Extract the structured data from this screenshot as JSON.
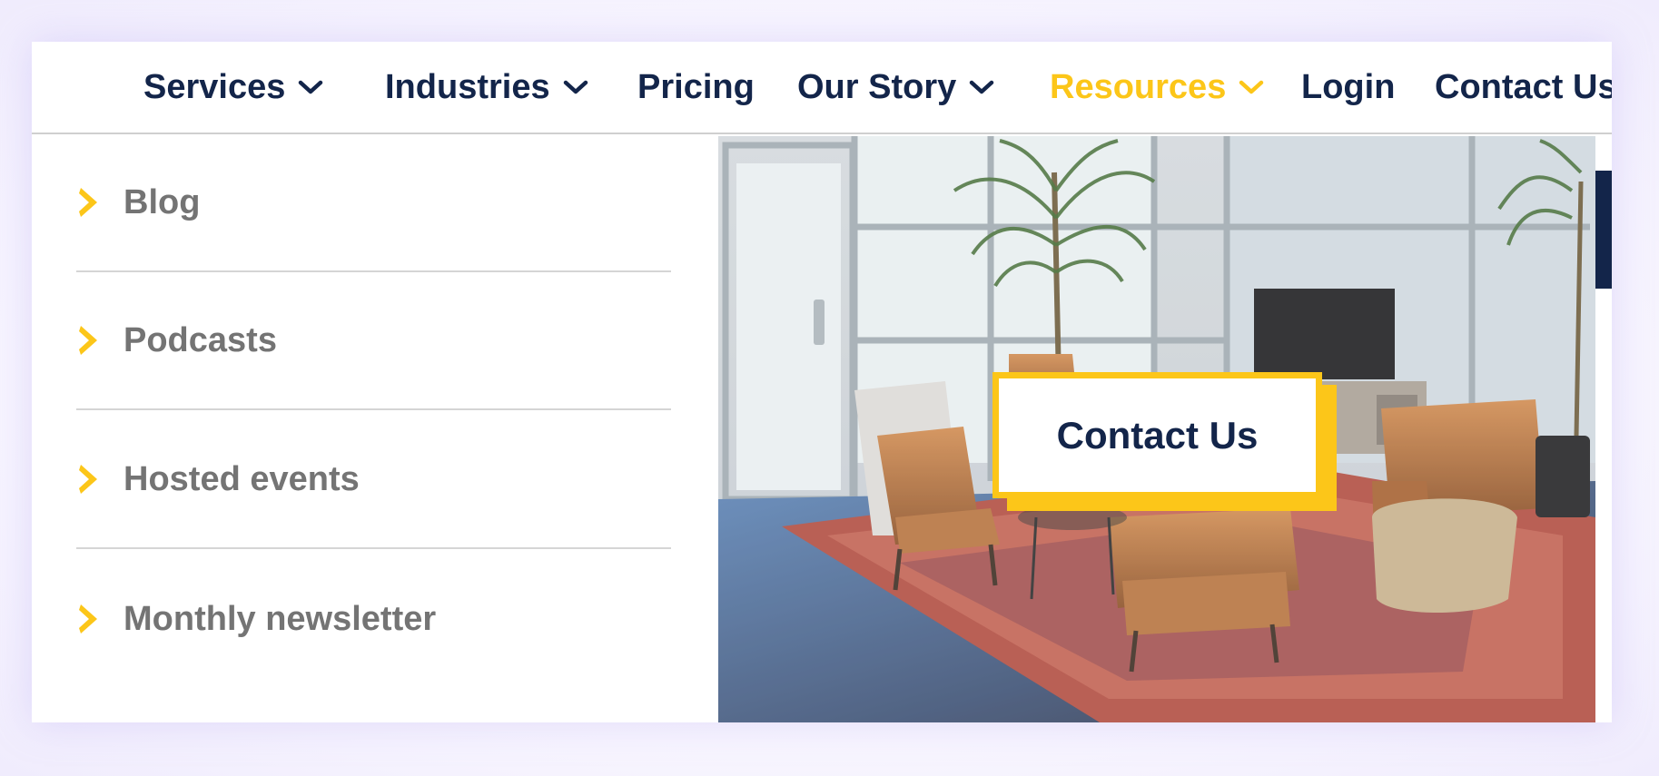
{
  "nav": {
    "items": [
      {
        "label": "Services",
        "has_dropdown": true
      },
      {
        "label": "Industries",
        "has_dropdown": true
      },
      {
        "label": "Pricing",
        "has_dropdown": false
      },
      {
        "label": "Our Story",
        "has_dropdown": true
      },
      {
        "label": "Resources",
        "has_dropdown": true,
        "active": true
      },
      {
        "label": "Login",
        "has_dropdown": false
      },
      {
        "label": "Contact Us",
        "has_dropdown": false
      }
    ]
  },
  "resources_menu": {
    "items": [
      {
        "label": "Blog",
        "icon": "chevron-right-icon"
      },
      {
        "label": "Podcasts",
        "icon": "chevron-right-icon"
      },
      {
        "label": "Hosted events",
        "icon": "chevron-right-icon"
      },
      {
        "label": "Monthly newsletter",
        "icon": "chevron-right-icon"
      }
    ]
  },
  "hero": {
    "image": "office-lounge-photo",
    "cta_label": "Contact Us"
  },
  "colors": {
    "navy": "#13254a",
    "accent_yellow": "#fcc619",
    "menu_text_gray": "#747474",
    "divider": "#d5d5d5"
  }
}
